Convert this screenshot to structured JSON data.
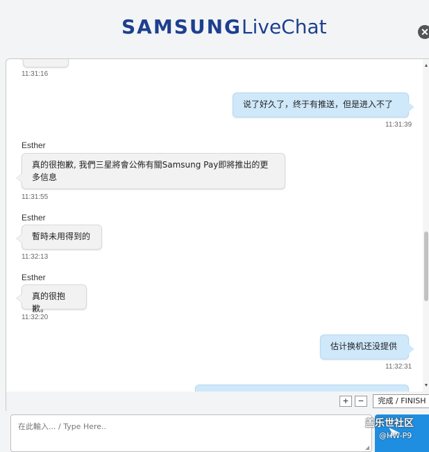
{
  "header": {
    "brand": "SAMSUNG",
    "product": "LiveChat",
    "close_symbol": "✕"
  },
  "messages": [
    {
      "time": "11:31:16"
    },
    {
      "text": "说了好久了，终于有推送，但是进入不了",
      "time": "11:31:39"
    },
    {
      "sender": "Esther",
      "text": "真的很抱歉, 我們三星將會公佈有關Samsung Pay即將推出的更多信息",
      "time": "11:31:55"
    },
    {
      "sender": "Esther",
      "text": "暫時未用得到的",
      "time": "11:32:13"
    },
    {
      "sender": "Esther",
      "text": "真的很抱歉。",
      "time": "11:32:20"
    },
    {
      "text": "估计换机还没提供",
      "time": "11:32:31"
    }
  ],
  "toolbar": {
    "zoom_in": "+",
    "zoom_out": "−",
    "finish_label": "完成 / FINISH"
  },
  "composer": {
    "placeholder": "在此輸入... / Type Here.."
  },
  "watermark": {
    "line1": "盖乐世社区",
    "line2": "@HW-P9"
  },
  "colors": {
    "brand": "#1d3f8e",
    "user_bubble": "#cfe8fa",
    "agent_bubble": "#f2f2f2",
    "send_button": "#1f8ee0"
  },
  "icons": {
    "close": "close-icon",
    "send": "send-icon",
    "resize": "resize-grip-icon"
  }
}
